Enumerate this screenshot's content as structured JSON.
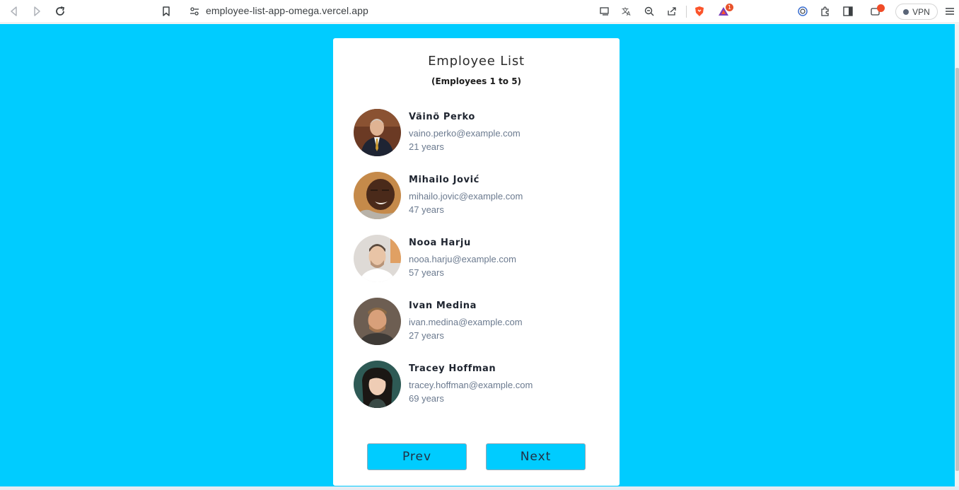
{
  "browser": {
    "url": "employee-list-app-omega.vercel.app",
    "vpn_label": "VPN",
    "notification_count": "1"
  },
  "card": {
    "title": "Employee List",
    "subtitle": "(Employees 1 to 5)"
  },
  "employees": [
    {
      "name": "Väinö Perko",
      "email": "vaino.perko@example.com",
      "age": "21 years"
    },
    {
      "name": "Mihailo Jović",
      "email": "mihailo.jovic@example.com",
      "age": "47 years"
    },
    {
      "name": "Nooa Harju",
      "email": "nooa.harju@example.com",
      "age": "57 years"
    },
    {
      "name": "Ivan Medina",
      "email": "ivan.medina@example.com",
      "age": "27 years"
    },
    {
      "name": "Tracey Hoffman",
      "email": "tracey.hoffman@example.com",
      "age": "69 years"
    }
  ],
  "pagination": {
    "prev_label": "Prev",
    "next_label": "Next"
  },
  "colors": {
    "page_background": "#00ccff",
    "button_background": "#00ccff",
    "card_background": "#ffffff"
  }
}
